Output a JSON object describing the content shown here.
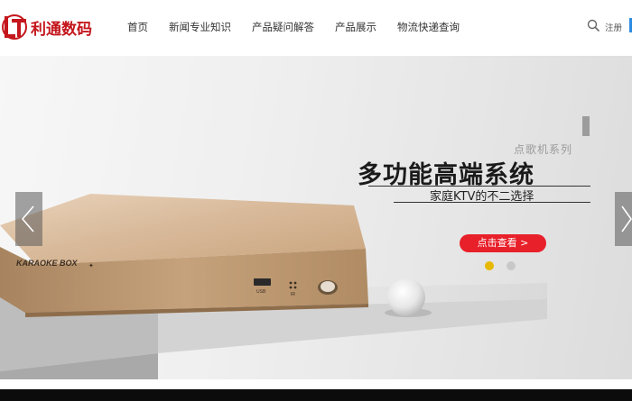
{
  "brand": {
    "logo_text": "利通数码",
    "logo_mark": "LT",
    "color": "#c4161c"
  },
  "nav": {
    "items": [
      "首页",
      "新闻专业知识",
      "产品疑问解答",
      "产品展示",
      "物流快递查询"
    ]
  },
  "header": {
    "search_icon": "search-icon",
    "register_label": "注册"
  },
  "banner": {
    "series_label": "点歌机系列",
    "headline": "多功能高端系统",
    "subheadline": "家庭KTV的不二选择",
    "cta_label": "点击查看 >",
    "product_label": "KARAOKE BOX",
    "usb_label": "USB",
    "ir_label": "IR",
    "slides_total": 2,
    "active_slide": 1,
    "accent_color": "#e8202a",
    "active_dot_color": "#e6b800"
  }
}
